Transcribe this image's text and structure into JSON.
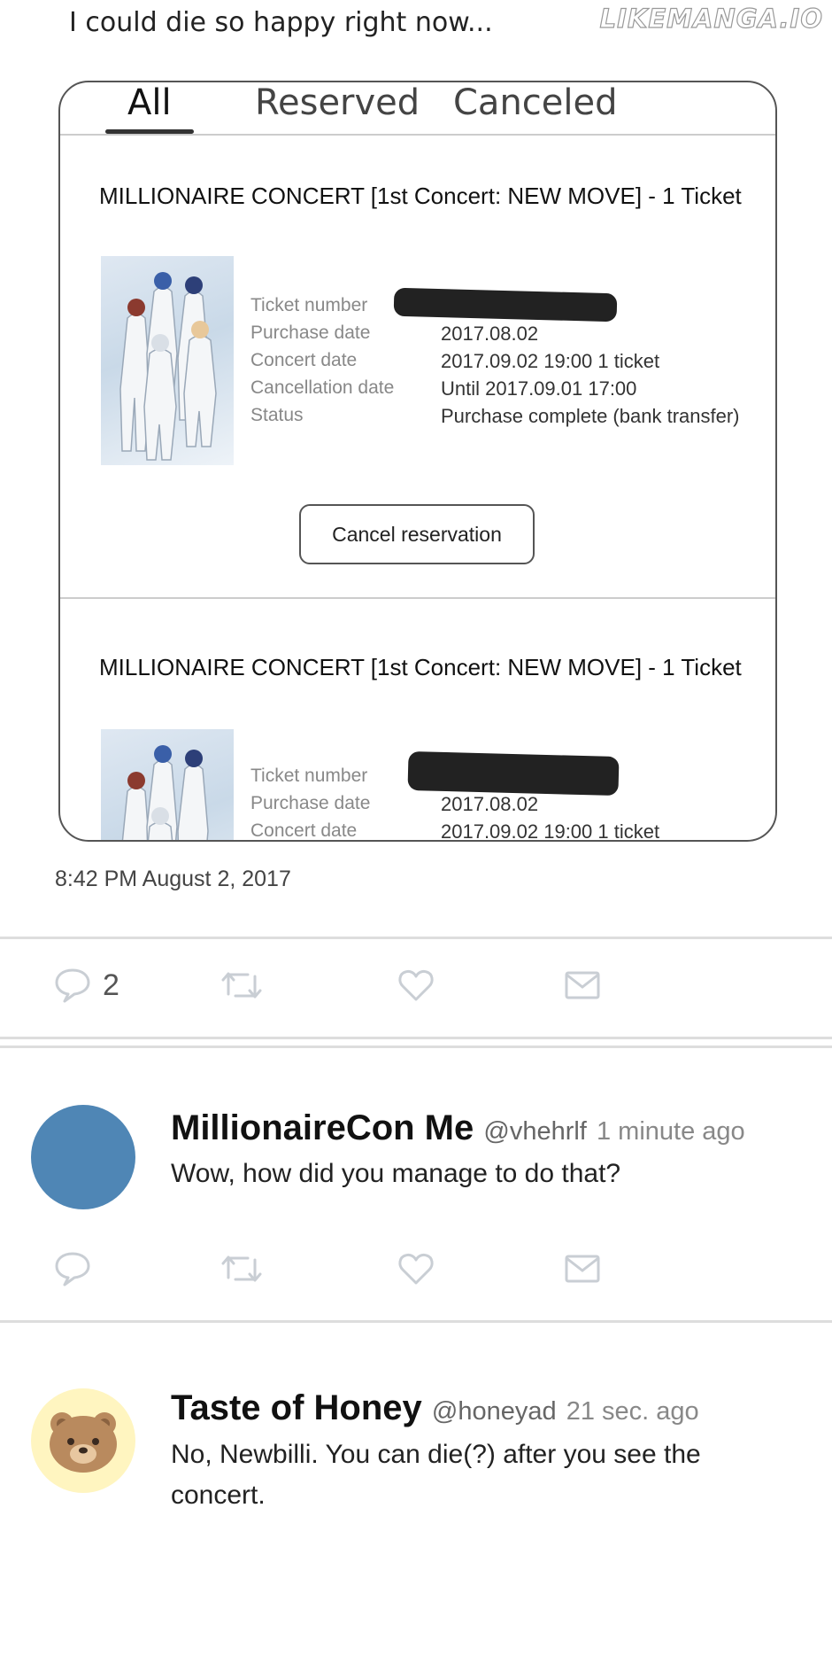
{
  "header": {
    "post_text": "I could die so happy right now...",
    "watermark": "LIKEMANGA.IO"
  },
  "screenshot": {
    "tabs": [
      {
        "label": "All",
        "active": true
      },
      {
        "label": "Reserved",
        "active": false
      },
      {
        "label": "Canceled",
        "active": false
      }
    ],
    "orders": [
      {
        "title": "MILLIONAIRE CONCERT [1st Concert: NEW MOVE] - 1 Ticket",
        "fields": [
          {
            "label": "Ticket number",
            "value": ""
          },
          {
            "label": "Purchase date",
            "value": "2017.08.02"
          },
          {
            "label": "Concert date",
            "value": "2017.09.02 19:00 1 ticket"
          },
          {
            "label": "Cancellation date",
            "value": "Until 2017.09.01 17:00"
          },
          {
            "label": "Status",
            "value": "Purchase complete (bank transfer)"
          }
        ],
        "button": "Cancel reservation"
      },
      {
        "title": "MILLIONAIRE CONCERT [1st Concert: NEW MOVE] - 1 Ticket",
        "fields": [
          {
            "label": "Ticket number",
            "value": ""
          },
          {
            "label": "Purchase date",
            "value": "2017.08.02"
          },
          {
            "label": "Concert date",
            "value": "2017.09.02 19:00 1 ticket"
          }
        ]
      }
    ]
  },
  "post": {
    "timestamp": "8:42 PM August 2, 2017",
    "reply_count": "2"
  },
  "replies": [
    {
      "name": "MillionaireCon Me",
      "handle": "@vhehrlf",
      "time": "1 minute ago",
      "text": "Wow, how did you manage to do that?",
      "avatar_color": "#4f86b5"
    },
    {
      "name": "Taste of Honey",
      "handle": "@honeyad",
      "time": "21 sec. ago",
      "text": "No, Newbilli. You can die(?) after you see the concert.",
      "avatar_color": "#fff5c0"
    }
  ],
  "icons": [
    "comment-icon",
    "retweet-icon",
    "heart-icon",
    "mail-icon"
  ]
}
